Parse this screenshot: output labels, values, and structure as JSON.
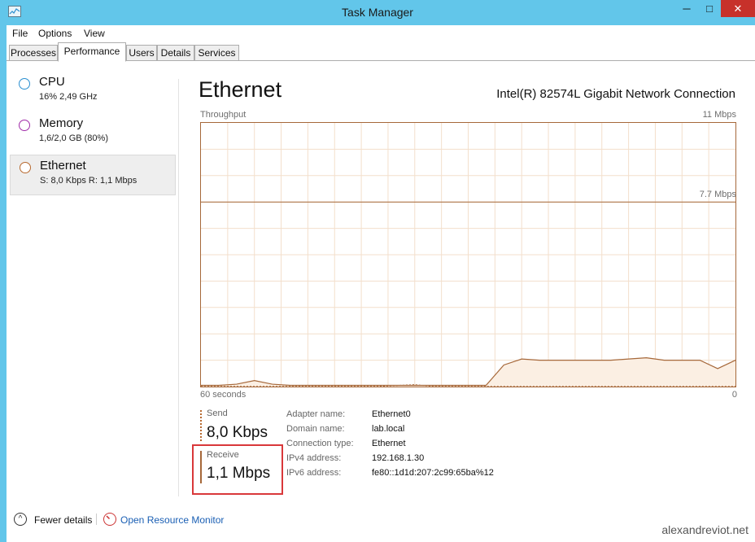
{
  "window": {
    "title": "Task Manager"
  },
  "menu": [
    "File",
    "Options",
    "View"
  ],
  "tabs": [
    "Processes",
    "Performance",
    "Users",
    "Details",
    "Services"
  ],
  "active_tab": "Performance",
  "sidebar": {
    "items": [
      {
        "title": "CPU",
        "subtitle": "16%  2,49 GHz",
        "color": "#2a8fd0"
      },
      {
        "title": "Memory",
        "subtitle": "1,6/2,0 GB (80%)",
        "color": "#a02ba8"
      },
      {
        "title": "Ethernet",
        "subtitle": "S: 8,0 Kbps  R: 1,1 Mbps",
        "color": "#b7692f",
        "selected": true
      }
    ]
  },
  "perf": {
    "title": "Ethernet",
    "device": "Intel(R) 82574L Gigabit Network Connection",
    "graph_label": "Throughput",
    "max_label": "11 Mbps",
    "mid_label": "7.7 Mbps",
    "time_label": "60 seconds",
    "zero_label": "0"
  },
  "chart_data": {
    "type": "area",
    "ylabel": "Throughput",
    "ylim": [
      0,
      11
    ],
    "xlim": [
      60,
      0
    ],
    "scale_line_value": 7.7,
    "series": [
      {
        "name": "Receive",
        "style": "solid",
        "x": [
          60,
          58,
          56,
          54,
          52,
          50,
          48,
          46,
          44,
          42,
          40,
          38,
          36,
          34,
          32,
          30,
          28,
          26,
          24,
          22,
          20,
          18,
          16,
          14,
          12,
          10,
          8,
          6,
          4,
          2,
          0
        ],
        "y": [
          0.05,
          0.05,
          0.1,
          0.25,
          0.1,
          0.05,
          0.05,
          0.05,
          0.05,
          0.05,
          0.05,
          0.05,
          0.05,
          0.05,
          0.05,
          0.05,
          0.05,
          0.9,
          1.15,
          1.1,
          1.1,
          1.1,
          1.1,
          1.1,
          1.15,
          1.2,
          1.1,
          1.1,
          1.1,
          0.75,
          1.1
        ]
      },
      {
        "name": "Send",
        "style": "dashed",
        "x": [
          60,
          50,
          40,
          36,
          34,
          30,
          20,
          10,
          0
        ],
        "y": [
          0.01,
          0.01,
          0.01,
          0.08,
          0.01,
          0.01,
          0.01,
          0.01,
          0.01
        ]
      }
    ],
    "colors": {
      "line": "#a6683a",
      "fill": "#fbefe3",
      "grid": "#f3dfcc"
    }
  },
  "send": {
    "label": "Send",
    "value": "8,0 Kbps"
  },
  "receive": {
    "label": "Receive",
    "value": "1,1 Mbps"
  },
  "details": [
    {
      "label": "Adapter name:",
      "value": "Ethernet0"
    },
    {
      "label": "Domain name:",
      "value": "lab.local"
    },
    {
      "label": "Connection type:",
      "value": "Ethernet"
    },
    {
      "label": "IPv4 address:",
      "value": "192.168.1.30"
    },
    {
      "label": "IPv6 address:",
      "value": "fe80::1d1d:207:2c99:65ba%12"
    }
  ],
  "footer": {
    "fewer_details": "Fewer details",
    "open_resource_monitor": "Open Resource Monitor",
    "watermark": "alexandreviot.net"
  }
}
